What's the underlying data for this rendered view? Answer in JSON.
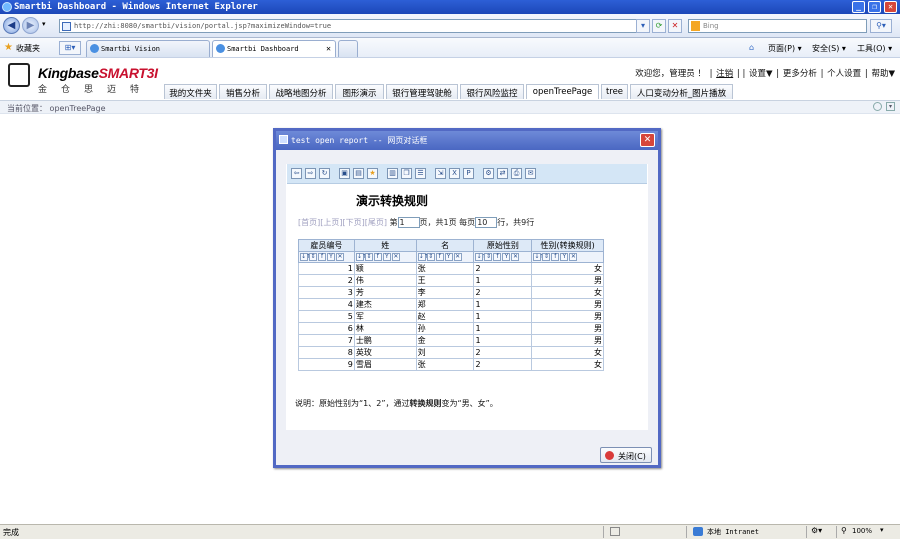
{
  "window": {
    "title": "Smartbi Dashboard - Windows Internet Explorer"
  },
  "address": {
    "url": "http://zhi:8080/smartbi/vision/portal.jsp?maximizeWindow=true",
    "search_placeholder": "Bing"
  },
  "favorites": {
    "label": "收藏夹",
    "tabs": [
      "Smartbi Vision",
      "Smartbi Dashboard"
    ]
  },
  "ie_toolbar": {
    "page": "页面(P) ▾",
    "safety": "安全(S) ▾",
    "tools": "工具(O) ▾"
  },
  "app": {
    "logo_main": "Kingbase",
    "logo_brand": "SMART3I",
    "logo_cn": "金仓思迈特",
    "top_links": {
      "welcome": "欢迎您，管理员 ！",
      "logout": "注销",
      "settings": "设置▼",
      "more": "更多分析",
      "personal": "个人设置",
      "help": "帮助▼"
    },
    "nav_tabs": [
      "我的文件夹",
      "销售分析",
      "战略地图分析",
      "图形演示",
      "银行管理驾驶舱",
      "银行风险监控",
      "openTreePage",
      "tree",
      "人口变动分析_图片播放"
    ],
    "active_tab": "openTreePage",
    "breadcrumb_label": "当前位置：",
    "breadcrumb_value": "openTreePage"
  },
  "dialog": {
    "title": "test open report -- 网页对话框",
    "report_title": "演示转换规则",
    "pager": {
      "first": "[首页]",
      "prev": "[上页]",
      "next": "[下页]",
      "last": "[尾页]",
      "page_prefix": "第",
      "page_value": "1",
      "page_suffix": "页，共1页 每页",
      "rows_value": "10",
      "rows_suffix": "行，共9行"
    },
    "columns": [
      "雇员编号",
      "姓",
      "名",
      "原始性别",
      "性别(转换规则)"
    ],
    "rows": [
      [
        "1",
        "颖",
        "张",
        "2",
        "女"
      ],
      [
        "2",
        "伟",
        "王",
        "1",
        "男"
      ],
      [
        "3",
        "芳",
        "李",
        "2",
        "女"
      ],
      [
        "4",
        "建杰",
        "郑",
        "1",
        "男"
      ],
      [
        "5",
        "军",
        "赵",
        "1",
        "男"
      ],
      [
        "6",
        "林",
        "孙",
        "1",
        "男"
      ],
      [
        "7",
        "士鹏",
        "金",
        "1",
        "男"
      ],
      [
        "8",
        "英玫",
        "刘",
        "2",
        "女"
      ],
      [
        "9",
        "雪眉",
        "张",
        "2",
        "女"
      ]
    ],
    "note_prefix": "说明：原始性别为“1、2”，通过",
    "note_bold": "转换规则",
    "note_suffix": "变为“男、女”。",
    "close_label": "关闭(C)"
  },
  "status": {
    "left": "完成",
    "zone": "本地 Intranet",
    "zoom": "100%"
  }
}
